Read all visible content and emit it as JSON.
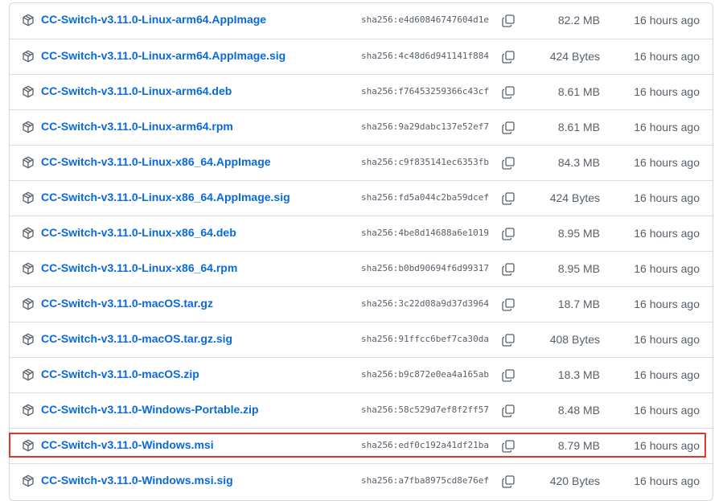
{
  "assets": [
    {
      "name": "CC-Switch-v3.11.0-Linux-arm64.AppImage",
      "sha": "sha256:e4d60846747604d1e",
      "size": "82.2 MB",
      "time": "16 hours ago"
    },
    {
      "name": "CC-Switch-v3.11.0-Linux-arm64.AppImage.sig",
      "sha": "sha256:4c48d6d941141f884",
      "size": "424 Bytes",
      "time": "16 hours ago"
    },
    {
      "name": "CC-Switch-v3.11.0-Linux-arm64.deb",
      "sha": "sha256:f76453259366c43cf",
      "size": "8.61 MB",
      "time": "16 hours ago"
    },
    {
      "name": "CC-Switch-v3.11.0-Linux-arm64.rpm",
      "sha": "sha256:9a29dabc137e52ef7",
      "size": "8.61 MB",
      "time": "16 hours ago"
    },
    {
      "name": "CC-Switch-v3.11.0-Linux-x86_64.AppImage",
      "sha": "sha256:c9f835141ec6353fb",
      "size": "84.3 MB",
      "time": "16 hours ago"
    },
    {
      "name": "CC-Switch-v3.11.0-Linux-x86_64.AppImage.sig",
      "sha": "sha256:fd5a044c2ba59dcef",
      "size": "424 Bytes",
      "time": "16 hours ago"
    },
    {
      "name": "CC-Switch-v3.11.0-Linux-x86_64.deb",
      "sha": "sha256:4be8d14688a6e1019",
      "size": "8.95 MB",
      "time": "16 hours ago"
    },
    {
      "name": "CC-Switch-v3.11.0-Linux-x86_64.rpm",
      "sha": "sha256:b0bd90694f6d99317",
      "size": "8.95 MB",
      "time": "16 hours ago"
    },
    {
      "name": "CC-Switch-v3.11.0-macOS.tar.gz",
      "sha": "sha256:3c22d08a9d37d3964",
      "size": "18.7 MB",
      "time": "16 hours ago"
    },
    {
      "name": "CC-Switch-v3.11.0-macOS.tar.gz.sig",
      "sha": "sha256:91ffcc6bef7ca30da",
      "size": "408 Bytes",
      "time": "16 hours ago"
    },
    {
      "name": "CC-Switch-v3.11.0-macOS.zip",
      "sha": "sha256:b9c872e0ea4a165ab",
      "size": "18.3 MB",
      "time": "16 hours ago"
    },
    {
      "name": "CC-Switch-v3.11.0-Windows-Portable.zip",
      "sha": "sha256:58c529d7ef8f2ff57",
      "size": "8.48 MB",
      "time": "16 hours ago"
    },
    {
      "name": "CC-Switch-v3.11.0-Windows.msi",
      "sha": "sha256:edf0c192a41df21ba",
      "size": "8.79 MB",
      "time": "16 hours ago",
      "highlighted": true
    },
    {
      "name": "CC-Switch-v3.11.0-Windows.msi.sig",
      "sha": "sha256:a7fba8975cd8e76ef",
      "size": "420 Bytes",
      "time": "16 hours ago"
    }
  ],
  "colors": {
    "link": "#0969da",
    "muted": "#57606a",
    "border": "#d0d7de",
    "highlight": "#e0362c"
  },
  "icons": {
    "asset": "package-icon",
    "copy": "copy-icon"
  }
}
